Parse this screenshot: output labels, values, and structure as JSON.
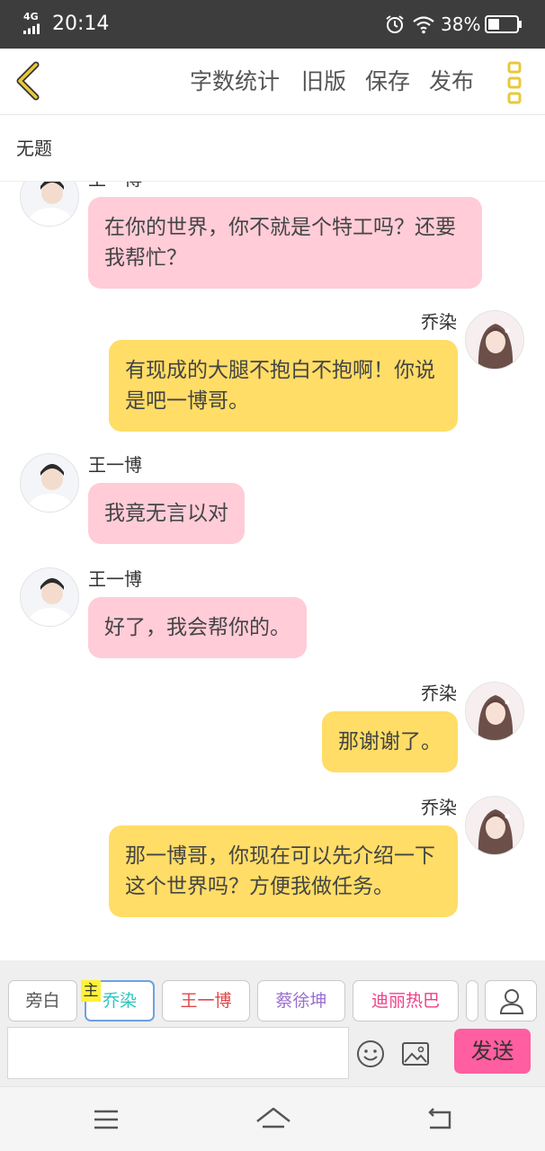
{
  "status_bar": {
    "network": "4G",
    "time": "20:14",
    "battery": "38%",
    "icons": [
      "signal-icon",
      "alarm-icon",
      "wifi-icon",
      "battery-icon"
    ]
  },
  "header": {
    "icons": {
      "back": "chevron-left-icon",
      "more": "more-vertical-icon"
    },
    "buttons": {
      "word_count": "字数统计",
      "old_version": "旧版",
      "save": "保存",
      "publish": "发布"
    },
    "accent": "#e8c93a"
  },
  "title": "无题",
  "messages": [
    {
      "side": "left",
      "speaker": "王一博",
      "text": "在你的世界，你不就是个特工吗？还要我帮忙？",
      "color": "#ffccd8"
    },
    {
      "side": "right",
      "speaker": "乔染",
      "text": "有现成的大腿不抱白不抱啊！你说是吧一博哥。",
      "color": "#ffdd66"
    },
    {
      "side": "left",
      "speaker": "王一博",
      "text": "我竟无言以对",
      "color": "#ffccd8"
    },
    {
      "side": "left",
      "speaker": "王一博",
      "text": "好了，我会帮你的。",
      "color": "#ffccd8"
    },
    {
      "side": "right",
      "speaker": "乔染",
      "text": "那谢谢了。",
      "color": "#ffdd66"
    },
    {
      "side": "right",
      "speaker": "乔染",
      "text": "那一博哥，你现在可以先介绍一下这个世界吗？方便我做任务。",
      "color": "#ffdd66"
    }
  ],
  "toolbar": {
    "roles": [
      {
        "label": "旁白",
        "color": "#555555"
      },
      {
        "label": "乔染",
        "color": "#2ec4c0"
      },
      {
        "label": "王一博",
        "color": "#e04848"
      },
      {
        "label": "蔡徐坤",
        "color": "#9b6fd0"
      },
      {
        "label": "迪丽热巴",
        "color": "#ef3f8a"
      }
    ],
    "main_badge": "主",
    "input_value": "",
    "input_placeholder": "",
    "send_label": "发送",
    "send_color": "#ff5ea0",
    "icons": {
      "user": "user-icon",
      "emoji": "emoji-icon",
      "image": "image-icon"
    }
  },
  "navbar": {
    "icons": [
      "menu-icon",
      "home-icon",
      "back-arrow-icon"
    ]
  }
}
